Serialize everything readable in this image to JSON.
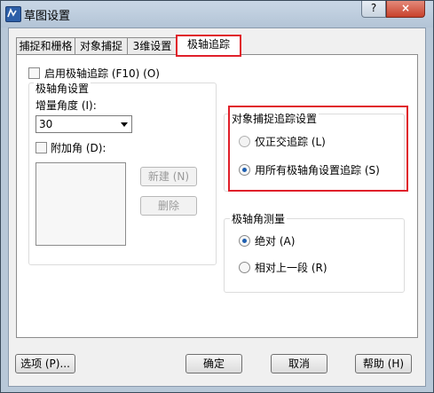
{
  "window": {
    "title": "草图设置",
    "help_glyph": "?",
    "close_glyph": "×"
  },
  "tabs": [
    {
      "label": "捕捉和栅格"
    },
    {
      "label": "对象捕捉"
    },
    {
      "label": "3维设置"
    },
    {
      "label": "极轴追踪"
    }
  ],
  "polar": {
    "enable_label": "启用极轴追踪 (F10) (O)",
    "angle_group_title": "极轴角设置",
    "increment_label": "增量角度 (I):",
    "increment_value": "30",
    "additional_label": "附加角 (D):",
    "new_button": "新建 (N)",
    "delete_button": "删除"
  },
  "object_snap_tracking": {
    "title": "对象捕捉追踪设置",
    "option_orthogonal": "仅正交追踪 (L)",
    "option_all": "用所有极轴角设置追踪 (S)",
    "selected": "option_all"
  },
  "measurement": {
    "title": "极轴角测量",
    "option_absolute": "绝对 (A)",
    "option_relative": "相对上一段 (R)",
    "selected": "option_absolute"
  },
  "footer": {
    "options_button": "选项 (P)...",
    "ok_button": "确定",
    "cancel_button": "取消",
    "help_button": "帮助 (H)"
  }
}
